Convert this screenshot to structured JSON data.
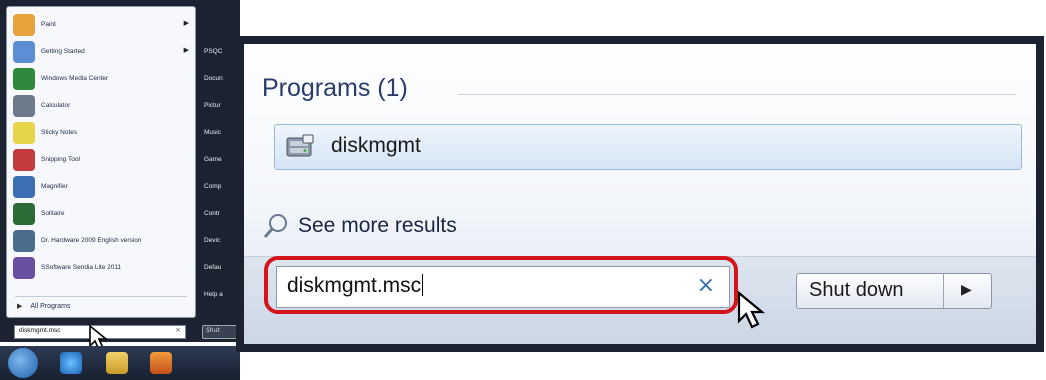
{
  "start_menu": {
    "items": [
      {
        "label": "Paint",
        "has_arrow": true,
        "color": "#e8a23c"
      },
      {
        "label": "Getting Started",
        "has_arrow": true,
        "color": "#5a8fd6"
      },
      {
        "label": "Windows Media Center",
        "has_arrow": false,
        "color": "#2e8a3a"
      },
      {
        "label": "Calculator",
        "has_arrow": false,
        "color": "#6d7a8c"
      },
      {
        "label": "Sticky Notes",
        "has_arrow": false,
        "color": "#e6d44a"
      },
      {
        "label": "Snipping Tool",
        "has_arrow": false,
        "color": "#c33b3b"
      },
      {
        "label": "Magnifier",
        "has_arrow": false,
        "color": "#3d6fb4"
      },
      {
        "label": "Solitaire",
        "has_arrow": false,
        "color": "#2c6a36"
      },
      {
        "label": "Dr. Hardware 2009 English version",
        "has_arrow": false,
        "color": "#4b6c8c"
      },
      {
        "label": "SSoftware Sendia Lite 2011",
        "has_arrow": false,
        "color": "#6a4fa3"
      }
    ],
    "all_programs": "All Programs",
    "search_value": "diskmgmt.msc",
    "clear_glyph": "×",
    "right_items": [
      "PSQC",
      "Docun",
      "Pictur",
      "Music",
      "Game",
      "Comp",
      "Contr",
      "Devic",
      "Defau",
      "Help a"
    ],
    "shutdown_label": "Shut"
  },
  "search_panel": {
    "section_title": "Programs (1)",
    "result_label": "diskmgmt",
    "see_more": "See more results",
    "search_value": "diskmgmt.msc",
    "clear_glyph": "×",
    "shutdown_label": "Shut down",
    "shutdown_arrow": "▶",
    "highlight_color": "#d3141a"
  }
}
